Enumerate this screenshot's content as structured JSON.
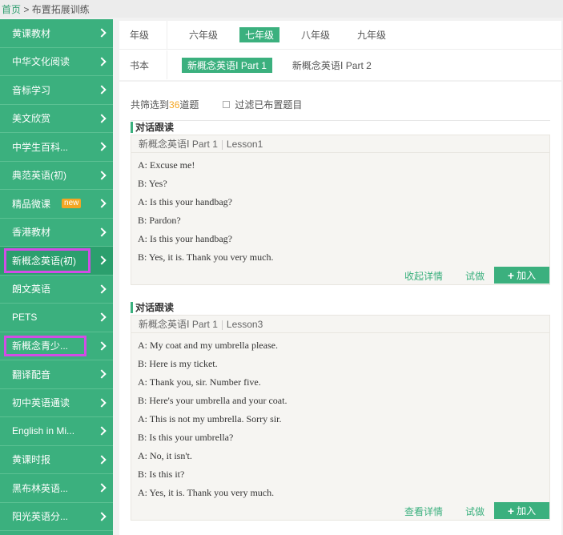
{
  "breadcrumb": {
    "home": "首页",
    "separator": " > ",
    "current": "布置拓展训练"
  },
  "sidebar": {
    "items": [
      {
        "label": "黄课教材"
      },
      {
        "label": "中华文化阅读"
      },
      {
        "label": "音标学习"
      },
      {
        "label": "美文欣赏"
      },
      {
        "label": "中学生百科..."
      },
      {
        "label": "典范英语(初)"
      },
      {
        "label": "精品微课",
        "badge": "new"
      },
      {
        "label": "香港教材"
      },
      {
        "label": "新概念英语(初)",
        "active": true
      },
      {
        "label": "朗文英语"
      },
      {
        "label": "PETS"
      },
      {
        "label": "新概念青少..."
      },
      {
        "label": "翻译配音"
      },
      {
        "label": "初中英语通读"
      },
      {
        "label": "English in Mi..."
      },
      {
        "label": "黄课时报"
      },
      {
        "label": "黑布林英语..."
      },
      {
        "label": "阳光英语分..."
      }
    ]
  },
  "filter": {
    "grade_label": "年级",
    "grades": [
      "六年级",
      "七年级",
      "八年级",
      "九年级"
    ],
    "grade_selected": "七年级",
    "book_label": "书本",
    "books": [
      "新概念英语Ⅰ Part 1",
      "新概念英语Ⅰ Part 2"
    ],
    "book_selected": "新概念英语Ⅰ Part 1"
  },
  "summary": {
    "prefix": "共筛选到",
    "count": "36",
    "suffix": "道题",
    "filter_label": "过滤已布置题目"
  },
  "cards": [
    {
      "type": "对话跟读",
      "book": "新概念英语Ⅰ Part 1",
      "lesson": "Lesson1",
      "lines": [
        "A: Excuse me!",
        "B: Yes?",
        "A: Is this your handbag?",
        "B: Pardon?",
        "A: Is this your handbag?",
        "B: Yes, it is. Thank you very much."
      ],
      "detail_label": "收起详情",
      "try_label": "试做",
      "add_label": "加入"
    },
    {
      "type": "对话跟读",
      "book": "新概念英语Ⅰ Part 1",
      "lesson": "Lesson3",
      "lines": [
        "A: My coat and my umbrella please.",
        "B: Here is my ticket.",
        "A: Thank you, sir. Number five.",
        "B: Here's your umbrella and your coat.",
        "A: This is not my umbrella. Sorry sir.",
        "B: Is this your umbrella?",
        "A: No, it isn't.",
        "B: Is this it?",
        "A: Yes, it is. Thank you very much."
      ],
      "detail_label": "查看详情",
      "try_label": "试做",
      "add_label": "加入"
    }
  ],
  "colors": {
    "accent": "#3bb07e",
    "highlight": "#d24ce6",
    "count": "#f5a623"
  }
}
